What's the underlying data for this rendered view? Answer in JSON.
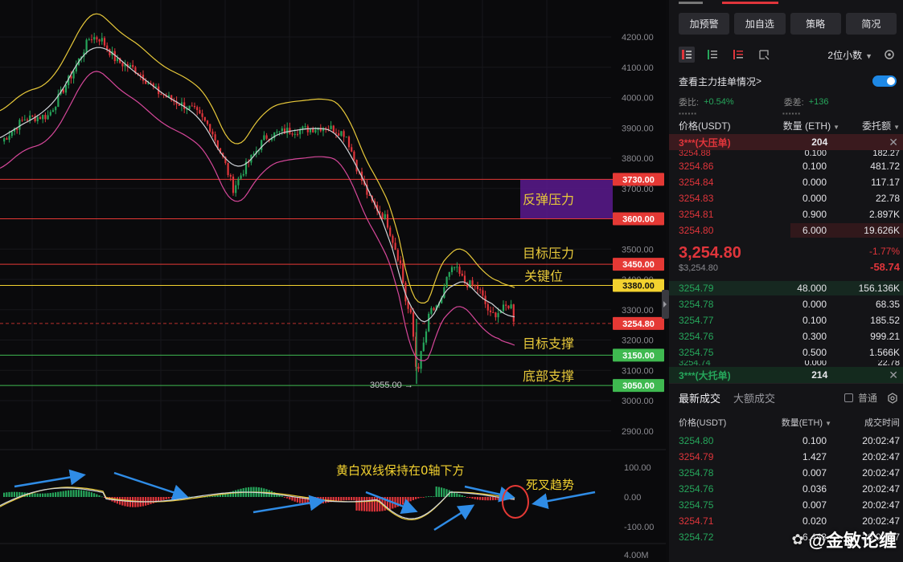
{
  "chart": {
    "price_axis": [
      "4200.00",
      "4100.00",
      "4000.00",
      "3900.00",
      "3800.00",
      "3700.00",
      "3600.00",
      "3500.00",
      "3400.00",
      "3300.00",
      "3200.00",
      "3100.00",
      "3000.00",
      "2900.00"
    ],
    "level_tags": [
      {
        "value": "3730.00",
        "price": 3730,
        "color": "#e53935",
        "text_color": "#ffffff"
      },
      {
        "value": "3600.00",
        "price": 3600,
        "color": "#e53935",
        "text_color": "#ffffff"
      },
      {
        "value": "3450.00",
        "price": 3450,
        "color": "#e53935",
        "text_color": "#ffffff"
      },
      {
        "value": "3380.00",
        "price": 3380,
        "color": "#f3d22f",
        "text_color": "#111111"
      },
      {
        "value": "3254.80",
        "price": 3254.8,
        "color": "#e53935",
        "text_color": "#ffffff"
      },
      {
        "value": "3150.00",
        "price": 3150,
        "color": "#3fb950",
        "text_color": "#ffffff"
      },
      {
        "value": "3050.00",
        "price": 3050,
        "color": "#3fb950",
        "text_color": "#ffffff"
      }
    ],
    "annotations": {
      "rebound_pressure": "反弹压力",
      "target_pressure": "目标压力",
      "key_level": "关键位",
      "target_support": "目标支撑",
      "bottom_support": "底部支撑",
      "macd_note": "黄白双线保持在0轴下方",
      "dead_cross": "死叉趋势"
    },
    "low_marker": "3055.00",
    "macd_axis": [
      "100.00",
      "0.00",
      "-100.00"
    ],
    "volume_axis": "4.00M",
    "colors": {
      "up": "#26a65b",
      "down": "#e0353b",
      "yellow": "#e8c93a",
      "white": "#cfd3d8",
      "pink": "#d6479a",
      "zone": "#5b1a8e",
      "arrow": "#2f8ce6"
    }
  },
  "panel": {
    "buttons": [
      "加预警",
      "加自选",
      "策略",
      "简况"
    ],
    "decimals": "2位小数",
    "check_label": "查看主力挂单情况",
    "ratio_label": "委比:",
    "ratio_value": "+0.54%",
    "diff_label": "委差:",
    "diff_value": "+136",
    "book_header": {
      "price": "价格(USDT)",
      "qty": "数量 (ETH)",
      "total": "委托额"
    },
    "ask_big": {
      "label": "3***(大压单)",
      "qty": "204"
    },
    "asks": [
      {
        "price": "3254.88",
        "qty": "0.100",
        "total": "182.27",
        "fill": 0
      },
      {
        "price": "3254.86",
        "qty": "0.100",
        "total": "481.72",
        "fill": 0
      },
      {
        "price": "3254.84",
        "qty": "0.000",
        "total": "117.17",
        "fill": 0
      },
      {
        "price": "3254.83",
        "qty": "0.000",
        "total": "22.78",
        "fill": 0
      },
      {
        "price": "3254.81",
        "qty": "0.900",
        "total": "2.897K",
        "fill": 0
      },
      {
        "price": "3254.80",
        "qty": "6.000",
        "total": "19.626K",
        "fill": 0.48
      }
    ],
    "last_price": "3,254.80",
    "last_price_sub": "$3,254.80",
    "change_pct": "-1.77%",
    "change_abs": "-58.74",
    "bids": [
      {
        "price": "3254.79",
        "qty": "48.000",
        "total": "156.136K",
        "fill": 1
      },
      {
        "price": "3254.78",
        "qty": "0.000",
        "total": "68.35",
        "fill": 0
      },
      {
        "price": "3254.77",
        "qty": "0.100",
        "total": "185.52",
        "fill": 0
      },
      {
        "price": "3254.76",
        "qty": "0.300",
        "total": "999.21",
        "fill": 0
      },
      {
        "price": "3254.75",
        "qty": "0.500",
        "total": "1.566K",
        "fill": 0
      },
      {
        "price": "3254.74",
        "qty": "0.000",
        "total": "22.78",
        "fill": 0
      }
    ],
    "bid_big": {
      "label": "3***(大托单)",
      "qty": "214"
    },
    "tabs": [
      "最新成交",
      "大额成交"
    ],
    "normal_label": "普通",
    "trade_header": {
      "price": "价格(USDT)",
      "qty": "数量(ETH)",
      "time": "成交时间"
    },
    "trades": [
      {
        "price": "3254.80",
        "qty": "0.100",
        "time": "20:02:47",
        "side": "buy"
      },
      {
        "price": "3254.79",
        "qty": "1.427",
        "time": "20:02:47",
        "side": "sell"
      },
      {
        "price": "3254.78",
        "qty": "0.007",
        "time": "20:02:47",
        "side": "buy"
      },
      {
        "price": "3254.76",
        "qty": "0.036",
        "time": "20:02:47",
        "side": "buy"
      },
      {
        "price": "3254.75",
        "qty": "0.007",
        "time": "20:02:47",
        "side": "buy"
      },
      {
        "price": "3254.71",
        "qty": "0.020",
        "time": "20:02:47",
        "side": "sell"
      },
      {
        "price": "3254.72",
        "qty": "6.443",
        "time": "20:02:47",
        "side": "buy"
      }
    ]
  },
  "watermark": "@金敏论缠"
}
